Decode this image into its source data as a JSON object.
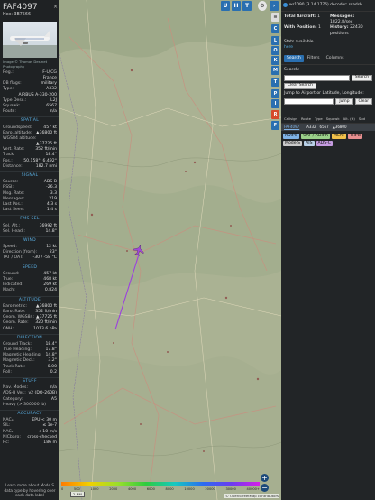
{
  "info": {
    "callsign": "FAF4097",
    "hex_line": "Hex: 3B7566",
    "close_glyph": "×",
    "photo_credit": "Image © Thomas Desmet Photography",
    "reg_rows": [
      {
        "k": "Reg.:",
        "v": "F-UJCG"
      },
      {
        "k": "",
        "v": "France"
      },
      {
        "k": "DB flags:",
        "v": "military"
      },
      {
        "k": "Type:",
        "v": "A332"
      },
      {
        "k": "",
        "v": "AIRBUS A-330-200"
      },
      {
        "k": "Type Desc.:",
        "v": "L2J"
      },
      {
        "k": "Squawk:",
        "v": "6567"
      },
      {
        "k": "Route:",
        "v": "n/a"
      }
    ],
    "sections": [
      {
        "title": "SPATIAL",
        "rows": [
          {
            "k": "Groundspeed:",
            "v": "457 kt"
          },
          {
            "k": "Baro. altitude:",
            "v": "▲36800 ft"
          },
          {
            "k": "WGS84 altitude:",
            "v": ""
          },
          {
            "k": "",
            "v": "▲37725 ft"
          },
          {
            "k": "Vert. Rate:",
            "v": "352 ft/min"
          },
          {
            "k": "Track:",
            "v": "18.4°"
          },
          {
            "k": "Pos.:",
            "v": "50.158°, 6.492°"
          },
          {
            "k": "Distance:",
            "v": "182.7 nmi"
          }
        ]
      },
      {
        "title": "SIGNAL",
        "rows": [
          {
            "k": "Source:",
            "v": "ADS-B"
          },
          {
            "k": "RSSI:",
            "v": "-26.3"
          },
          {
            "k": "Msg. Rate:",
            "v": "3.3"
          },
          {
            "k": "Messages:",
            "v": "219"
          },
          {
            "k": "Last Pos.:",
            "v": "4.3 s"
          },
          {
            "k": "Last Seen:",
            "v": "1.4 s"
          }
        ]
      },
      {
        "title": "FMS SEL",
        "rows": [
          {
            "k": "Sel. Alt.:",
            "v": "36992 ft"
          },
          {
            "k": "Sel. Head.:",
            "v": "14.8°"
          }
        ]
      },
      {
        "title": "WIND",
        "rows": [
          {
            "k": "Speed:",
            "v": "12 kt"
          },
          {
            "k": "Direction (from):",
            "v": "23°"
          },
          {
            "k": "TAT / OAT:",
            "v": "-30 / -58 °C"
          }
        ]
      },
      {
        "title": "SPEED",
        "rows": [
          {
            "k": "Ground:",
            "v": "457 kt"
          },
          {
            "k": "True:",
            "v": "468 kt"
          },
          {
            "k": "Indicated:",
            "v": "269 kt"
          },
          {
            "k": "Mach:",
            "v": "0.824"
          }
        ]
      },
      {
        "title": "ALTITUDE",
        "rows": [
          {
            "k": "Barometric:",
            "v": "▲36800 ft"
          },
          {
            "k": "Baro. Rate:",
            "v": "352 ft/min"
          },
          {
            "k": "Geom. WGS84:",
            "v": "▲37725 ft"
          },
          {
            "k": "Geom. Rate:",
            "v": "320 ft/min"
          },
          {
            "k": "QNH:",
            "v": "1013.6 hPa"
          }
        ]
      },
      {
        "title": "DIRECTION",
        "rows": [
          {
            "k": "Ground Track:",
            "v": "18.4°"
          },
          {
            "k": "True Heading:",
            "v": "17.8°"
          },
          {
            "k": "Magnetic Heading:",
            "v": "14.8°"
          },
          {
            "k": "Magnetic Decl.:",
            "v": "3.2°"
          },
          {
            "k": "Track Rate:",
            "v": "0.00"
          },
          {
            "k": "Roll:",
            "v": "0.2"
          }
        ]
      },
      {
        "title": "STUFF",
        "rows": [
          {
            "k": "Nav. Modes:",
            "v": "n/a"
          },
          {
            "k": "ADS-B Ver.:",
            "v": "v2 (DO-260B)"
          },
          {
            "k": "Category:",
            "v": "A5"
          },
          {
            "k": "Heavy (> 300000 lb)",
            "v": ""
          }
        ]
      },
      {
        "title": "ACCURACY",
        "rows": [
          {
            "k": "NACₚ:",
            "v": "EPU < 30 m"
          },
          {
            "k": "SIL:",
            "v": "≤ 1e-7"
          },
          {
            "k": "NACᵥ:",
            "v": "< 10 m/s"
          },
          {
            "k": "NICbaro:",
            "v": "cross-checked"
          },
          {
            "k": "Rc:",
            "v": "186 m"
          }
        ]
      }
    ],
    "footer": "Learn more about Mode S data type by hovering over each data label"
  },
  "map": {
    "top_buttons": [
      "U",
      "H",
      "T"
    ],
    "side_buttons": [
      "C",
      "L",
      "O",
      "K",
      "M",
      "T",
      "P",
      "I",
      "R",
      "F"
    ],
    "color_labels": [
      "0",
      "500",
      "1000",
      "2000",
      "4000",
      "6000",
      "8000",
      "10000",
      "20000",
      "30000",
      "40000+"
    ],
    "scale_label": "2 NM",
    "attribution": "© OpenStreetMap contributors",
    "zoom_in": "+",
    "zoom_out": "−",
    "plane_color": "#a04ad6",
    "track_color": "#9b3fe0"
  },
  "side": {
    "version_link": "wr1090 (3.14.1776) decoder: readsb",
    "stats": [
      {
        "k": "Total Aircraft:",
        "v": "1"
      },
      {
        "k": "Messages:",
        "v": "1822.8/sec"
      },
      {
        "k": "With Position:",
        "v": "1"
      },
      {
        "k": "History:",
        "v": "22430 positions"
      }
    ],
    "stats_available": "Stats available",
    "stats_link": "here",
    "tabs": [
      "Search",
      "Filters",
      "Columns"
    ],
    "search_label": "Search:",
    "search_button": "Search",
    "clear_search": "Clear Search",
    "jump_label": "Jump to Airport or Latitude, Longitude:",
    "jump_button": "Jump",
    "clear_button": "Clear",
    "table_headers": [
      "Callsign",
      "Route",
      "Type",
      "Squawk",
      "Alt. (ft)",
      "Spd"
    ],
    "table_row": [
      "FAF4097",
      "",
      "A332",
      "6567",
      "▲36800",
      ""
    ],
    "tags": [
      {
        "label": "ADS-B",
        "color": "#7fb2e5"
      },
      {
        "label": "UAT / ADS-R",
        "color": "#9bd18a"
      },
      {
        "label": "MLAT",
        "color": "#f0c04a"
      },
      {
        "label": "TIS-B",
        "color": "#e88f8f"
      },
      {
        "label": "Mode-S",
        "color": "#c9c9c9"
      },
      {
        "label": "AIS",
        "color": "#b9d1e8"
      },
      {
        "label": "ADS-C",
        "color": "#c49be0"
      }
    ]
  }
}
